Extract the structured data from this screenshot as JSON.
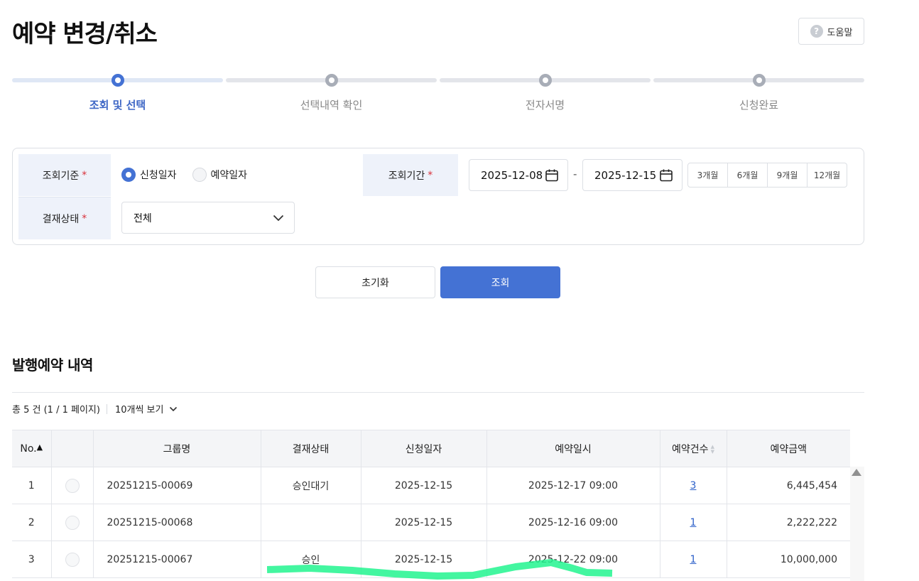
{
  "page": {
    "title": "예약 변경/취소",
    "help_label": "도움말",
    "help_glyph": "?"
  },
  "steps": [
    {
      "label": "조회 및 선택",
      "active": true
    },
    {
      "label": "선택내역 확인",
      "active": false
    },
    {
      "label": "전자서명",
      "active": false
    },
    {
      "label": "신청완료",
      "active": false
    }
  ],
  "filter": {
    "criteria_label": "조회기준",
    "required_mark": "*",
    "radio_options": [
      {
        "label": "신청일자",
        "checked": true
      },
      {
        "label": "예약일자",
        "checked": false
      }
    ],
    "status_label": "결재상태",
    "status_value": "전체",
    "period_label": "조회기간",
    "date_from": "2025-12-08",
    "date_separator": "-",
    "date_to": "2025-12-15",
    "period_buttons": [
      "3개월",
      "6개월",
      "9개월",
      "12개월"
    ]
  },
  "actions": {
    "reset_label": "초기화",
    "search_label": "조회"
  },
  "results": {
    "title": "발행예약 내역",
    "summary": "총 5 건 (1 / 1 페이지)",
    "page_size_label": "10개씩 보기",
    "columns": [
      "No.",
      "",
      "그룹명",
      "결재상태",
      "신청일자",
      "예약일시",
      "예약건수",
      "예약금액"
    ],
    "rows": [
      {
        "no": "1",
        "group": "20251215-00069",
        "status": "승인대기",
        "applied": "2025-12-15",
        "reserved_at": "2025-12-17 09:00",
        "count": "3",
        "amount": "6,445,454"
      },
      {
        "no": "2",
        "group": "20251215-00068",
        "status": "",
        "applied": "2025-12-15",
        "reserved_at": "2025-12-16 09:00",
        "count": "1",
        "amount": "2,222,222"
      },
      {
        "no": "3",
        "group": "20251215-00067",
        "status": "승인",
        "applied": "2025-12-15",
        "reserved_at": "2025-12-22 09:00",
        "count": "1",
        "amount": "10,000,000"
      }
    ]
  },
  "colors": {
    "accent": "#4472d4",
    "required": "#d9303a",
    "label_bg": "#eef2fa",
    "highlight": "#22f58f"
  }
}
